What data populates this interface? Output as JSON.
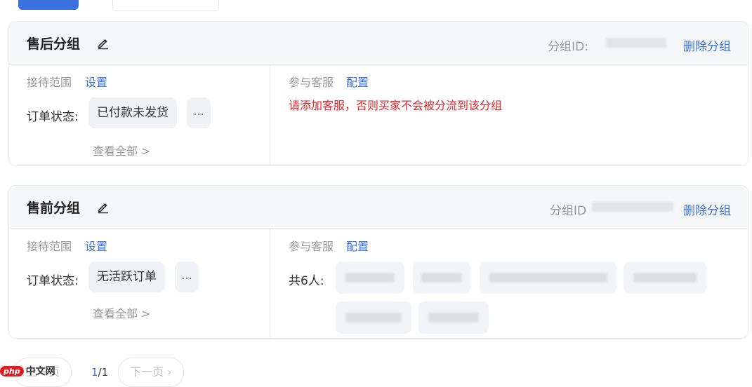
{
  "groups": [
    {
      "title": "售后分组",
      "id_label": "分组ID:",
      "delete": "删除分组",
      "scope_label": "接待范围",
      "scope_link": "设置",
      "order_status_label": "订单状态:",
      "order_status_value": "已付款未发货",
      "more": "...",
      "view_all": "查看全部 >",
      "agents_label": "参与客服",
      "agents_link": "配置",
      "warning": "请添加客服，否则买家不会被分流到该分组"
    },
    {
      "title": "售前分组",
      "id_label": "分组ID",
      "delete": "删除分组",
      "scope_label": "接待范围",
      "scope_link": "设置",
      "order_status_label": "订单状态:",
      "order_status_value": "无活跃订单",
      "more": "...",
      "view_all": "查看全部 >",
      "agents_label": "参与客服",
      "agents_link": "配置",
      "agents_count": "共6人:"
    }
  ],
  "pagination": {
    "prev": "上一页",
    "current": "1",
    "total": "/1",
    "next": "下一页 ›"
  },
  "watermark": {
    "logo": "php",
    "text": "中文网"
  },
  "colors": {
    "link": "#3b73e0",
    "warning": "#e4262c",
    "card_header_bg": "#f6f7f9",
    "tag_bg": "#f1f2f5"
  }
}
